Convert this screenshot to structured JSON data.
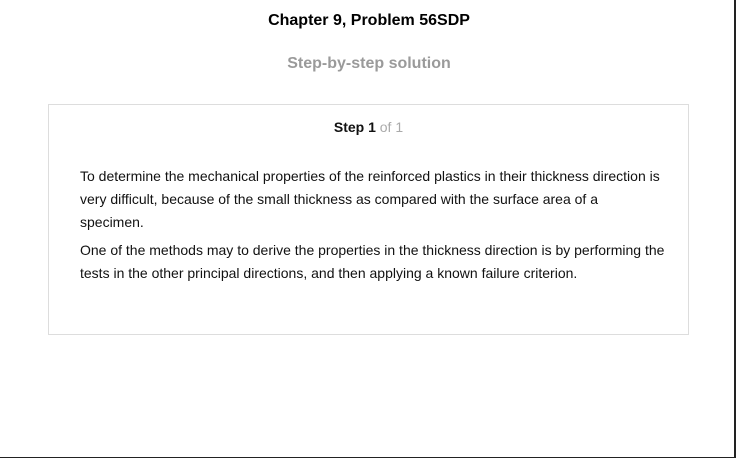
{
  "header": {
    "title": "Chapter 9, Problem 56SDP",
    "subtitle": "Step-by-step solution"
  },
  "step": {
    "label": "Step 1",
    "of": "of 1",
    "paragraphs": [
      "To determine the mechanical properties of the reinforced plastics in their thickness direction is very difficult, because of the small thickness as compared with the surface area of a specimen.",
      "One of the methods may to derive the properties in the thickness direction is by performing the tests in the other principal directions, and then applying a known failure criterion."
    ]
  }
}
